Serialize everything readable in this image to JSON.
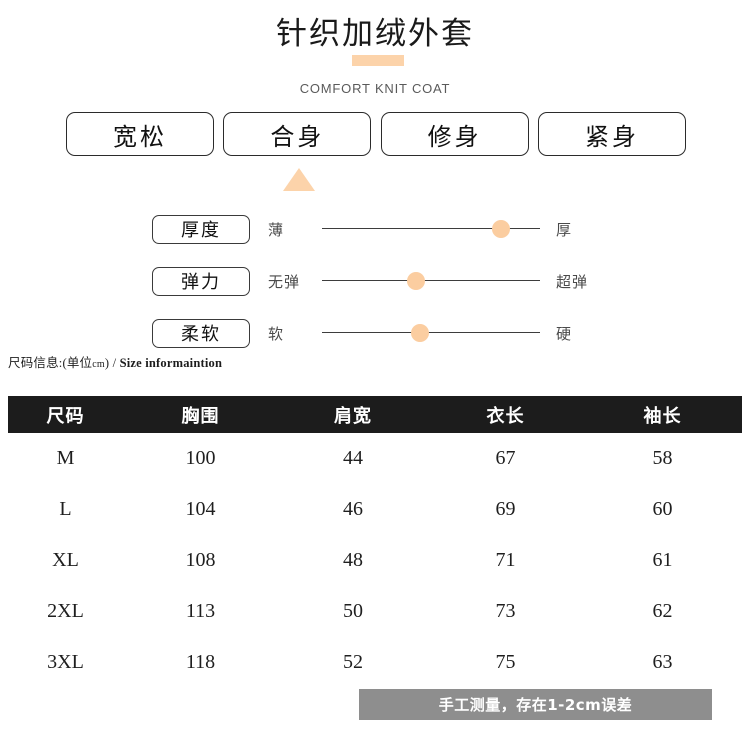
{
  "header": {
    "title": "针织加绒外套",
    "subtitle": "COMFORT KNIT COAT",
    "accent_color": "#fcd3aa"
  },
  "fit_options": [
    {
      "label": "宽松",
      "selected": false
    },
    {
      "label": "合身",
      "selected": true
    },
    {
      "label": "修身",
      "selected": false
    },
    {
      "label": "紧身",
      "selected": false
    }
  ],
  "properties": [
    {
      "tag": "厚度",
      "left_label": "薄",
      "right_label": "厚",
      "value_percent": 82
    },
    {
      "tag": "弹力",
      "left_label": "无弹",
      "right_label": "超弹",
      "value_percent": 43
    },
    {
      "tag": "柔软",
      "left_label": "软",
      "right_label": "硬",
      "value_percent": 45
    }
  ],
  "size_section": {
    "caption_cn": "尺码信息:(单位",
    "caption_unit": "cm",
    "caption_cn_close": ") / ",
    "caption_en": "Size informaintion",
    "columns": [
      "尺码",
      "胸围",
      "肩宽",
      "衣长",
      "袖长"
    ],
    "rows": [
      [
        "M",
        "100",
        "44",
        "67",
        "58"
      ],
      [
        "L",
        "104",
        "46",
        "69",
        "60"
      ],
      [
        "XL",
        "108",
        "48",
        "71",
        "61"
      ],
      [
        "2XL",
        "113",
        "50",
        "73",
        "62"
      ],
      [
        "3XL",
        "118",
        "52",
        "75",
        "63"
      ]
    ]
  },
  "footer": {
    "note": "手工测量，存在1-2cm误差",
    "background_color": "#8e8e8e"
  }
}
